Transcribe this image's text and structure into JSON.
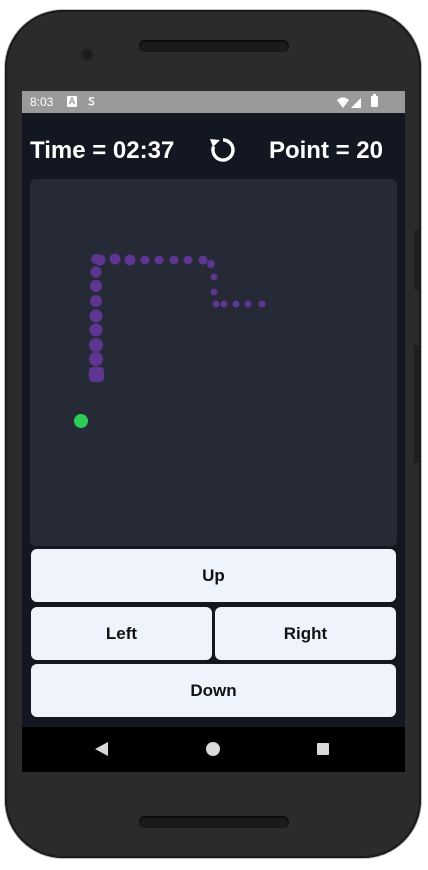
{
  "status_bar": {
    "time": "8:03",
    "icons": [
      "a-notification-icon",
      "s-notification-icon",
      "wifi-icon",
      "signal-icon",
      "battery-icon"
    ]
  },
  "header": {
    "time_text": "Time = 02:37",
    "point_text": "Point = 20",
    "restart_icon": "refresh-icon"
  },
  "game": {
    "colors": {
      "board_background": "#262a36",
      "snake": "#5e3590",
      "food": "#2ecc57"
    },
    "snake_segments": 27,
    "food_count": 1
  },
  "controls": {
    "up_label": "Up",
    "left_label": "Left",
    "right_label": "Right",
    "down_label": "Down"
  },
  "navigation_bar": {
    "icons": [
      "back-icon",
      "home-icon",
      "recents-icon"
    ]
  }
}
